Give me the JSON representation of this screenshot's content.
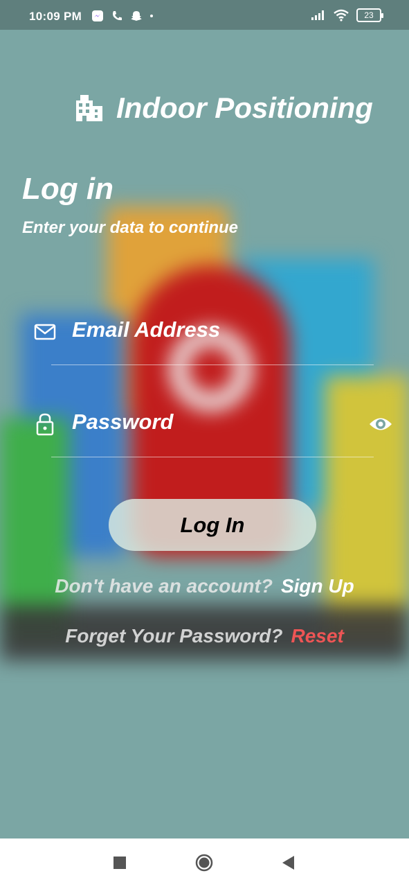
{
  "status_bar": {
    "time": "10:09 PM",
    "battery": "23"
  },
  "app": {
    "title": "Indoor Positioning"
  },
  "login": {
    "heading": "Log in",
    "subheading": "Enter your data to continue",
    "email_placeholder": "Email Address",
    "password_placeholder": "Password",
    "button_label": "Log In",
    "no_account_text": "Don't have an account?",
    "signup_label": "Sign Up",
    "forgot_text": "Forget Your Password?",
    "reset_label": "Reset"
  },
  "colors": {
    "background": "#7ba6a4",
    "accent_red": "#ee5555",
    "text": "#ffffff"
  },
  "icons": [
    "building-icon",
    "mail-icon",
    "lock-icon",
    "eye-icon"
  ]
}
